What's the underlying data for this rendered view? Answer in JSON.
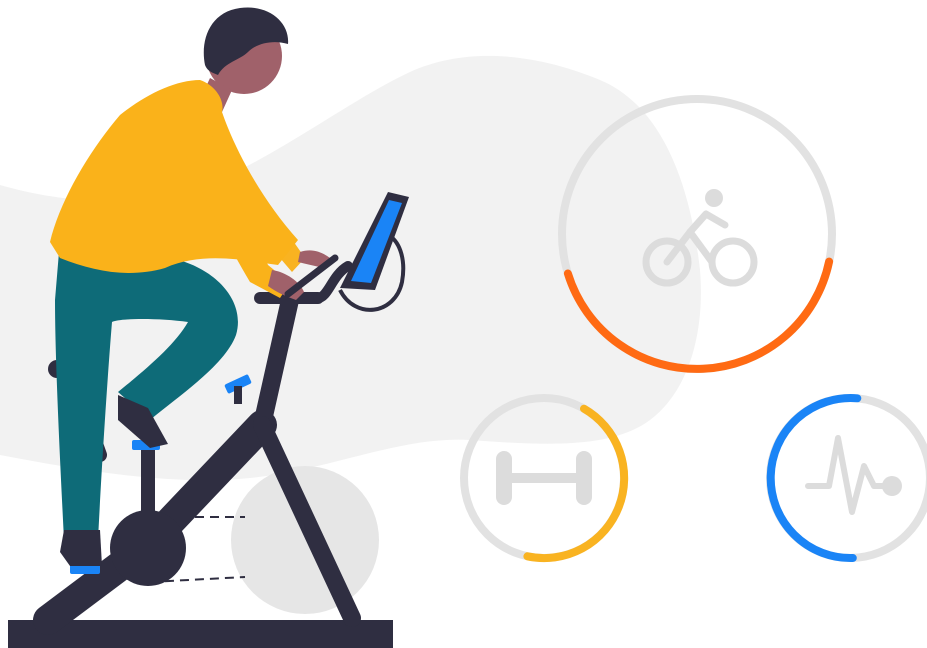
{
  "colors": {
    "background": "#ffffff",
    "blob": "#f2f2f2",
    "ring_track": "#e2e2e2",
    "icon_gray": "#dcdcdc",
    "cycling_accent": "#ff6a13",
    "strength_accent": "#f9b321",
    "heart_accent": "#1a84f6",
    "shirt": "#fab21a",
    "pants": "#0e6b78",
    "skin": "#a0616a",
    "hair": "#2f2e41",
    "bike_frame": "#2f2e41",
    "pedal_blue": "#1a84f6",
    "tablet_screen": "#1a84f6"
  },
  "progress": {
    "cycling": 0.42,
    "strength": 0.45,
    "heart": 0.52
  },
  "icons": {
    "cycling": "cyclist-icon",
    "strength": "dumbbell-icon",
    "heart": "heartbeat-icon",
    "person": "person-on-bike-illustration",
    "bike": "exercise-bike-icon",
    "tablet": "tablet-icon"
  }
}
